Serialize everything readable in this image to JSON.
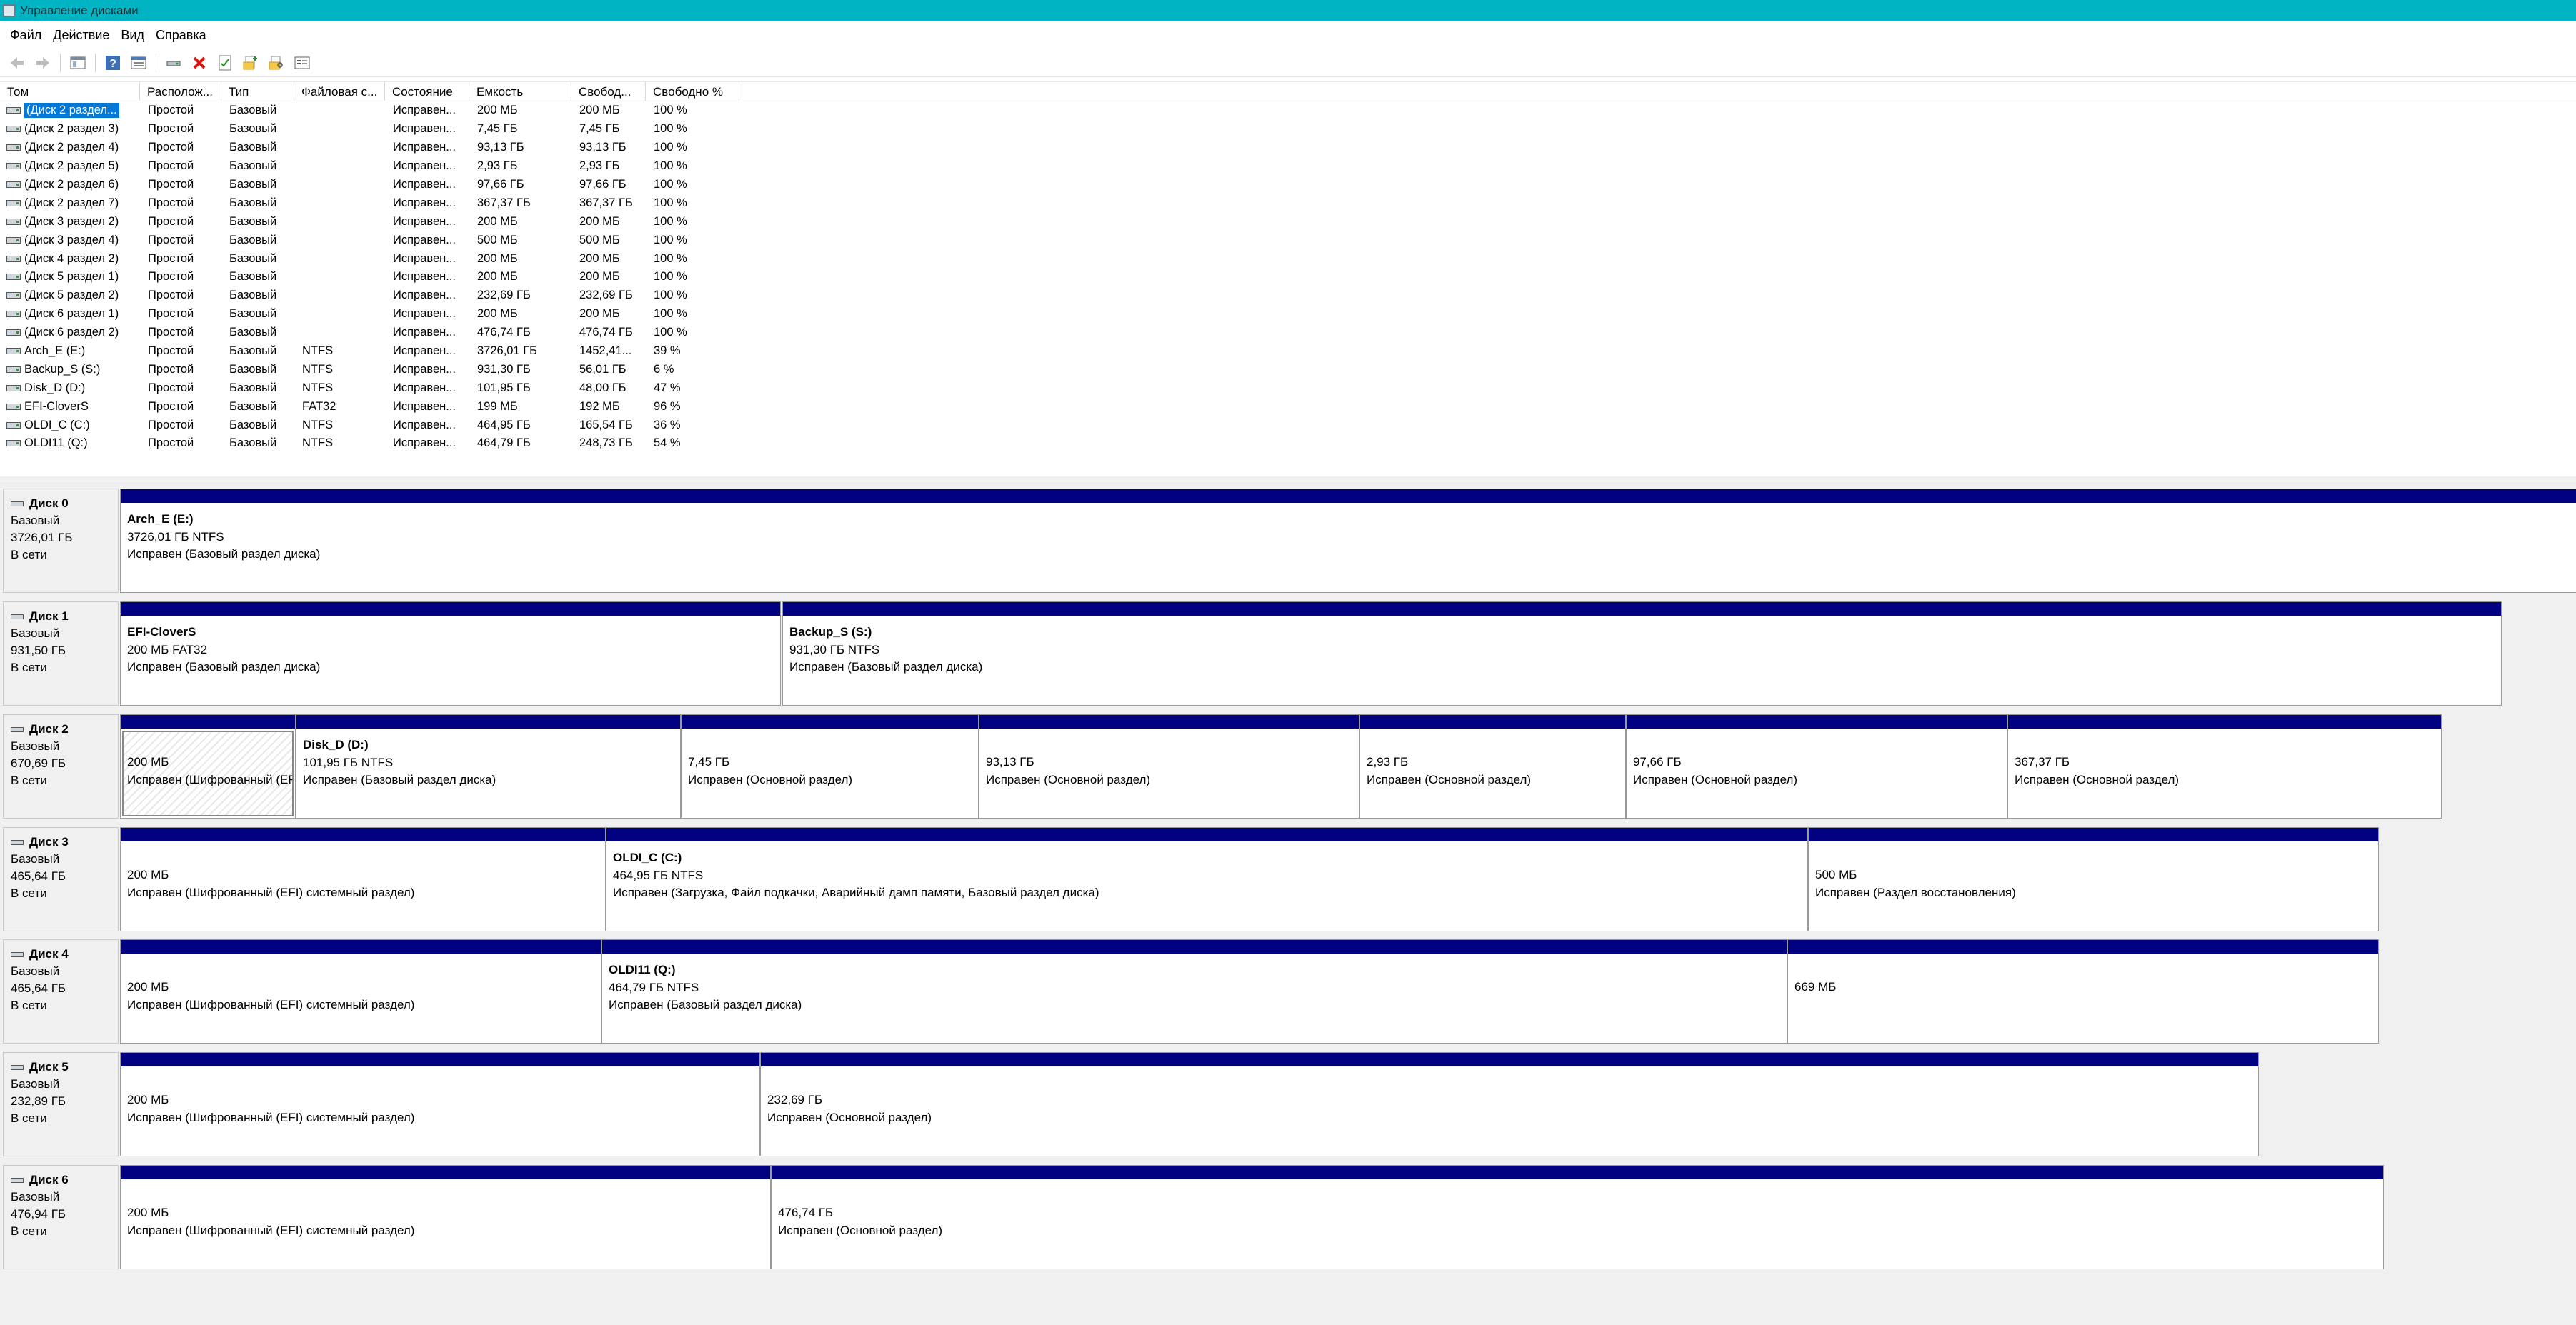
{
  "window": {
    "title": "Управление дисками"
  },
  "menu": [
    "Файл",
    "Действие",
    "Вид",
    "Справка"
  ],
  "toolbar_icons": [
    "back-arrow-icon",
    "forward-arrow-icon",
    "console-tree-icon",
    "help-icon",
    "list-view-icon",
    "connect-disk-icon",
    "delete-icon",
    "properties-icon",
    "folder-open-icon",
    "search-folder-icon",
    "settings-icon"
  ],
  "columns": [
    "Том",
    "Располож...",
    "Тип",
    "Файловая с...",
    "Состояние",
    "Емкость",
    "Свобод...",
    "Свободно %"
  ],
  "volumes": [
    [
      "(Диск 2 раздел...",
      "Простой",
      "Базовый",
      "",
      "Исправен...",
      "200 МБ",
      "200 МБ",
      "100 %"
    ],
    [
      "(Диск 2 раздел 3)",
      "Простой",
      "Базовый",
      "",
      "Исправен...",
      "7,45 ГБ",
      "7,45 ГБ",
      "100 %"
    ],
    [
      "(Диск 2 раздел 4)",
      "Простой",
      "Базовый",
      "",
      "Исправен...",
      "93,13 ГБ",
      "93,13 ГБ",
      "100 %"
    ],
    [
      "(Диск 2 раздел 5)",
      "Простой",
      "Базовый",
      "",
      "Исправен...",
      "2,93 ГБ",
      "2,93 ГБ",
      "100 %"
    ],
    [
      "(Диск 2 раздел 6)",
      "Простой",
      "Базовый",
      "",
      "Исправен...",
      "97,66 ГБ",
      "97,66 ГБ",
      "100 %"
    ],
    [
      "(Диск 2 раздел 7)",
      "Простой",
      "Базовый",
      "",
      "Исправен...",
      "367,37 ГБ",
      "367,37 ГБ",
      "100 %"
    ],
    [
      "(Диск 3 раздел 2)",
      "Простой",
      "Базовый",
      "",
      "Исправен...",
      "200 МБ",
      "200 МБ",
      "100 %"
    ],
    [
      "(Диск 3 раздел 4)",
      "Простой",
      "Базовый",
      "",
      "Исправен...",
      "500 МБ",
      "500 МБ",
      "100 %"
    ],
    [
      "(Диск 4 раздел 2)",
      "Простой",
      "Базовый",
      "",
      "Исправен...",
      "200 МБ",
      "200 МБ",
      "100 %"
    ],
    [
      "(Диск 5 раздел 1)",
      "Простой",
      "Базовый",
      "",
      "Исправен...",
      "200 МБ",
      "200 МБ",
      "100 %"
    ],
    [
      "(Диск 5 раздел 2)",
      "Простой",
      "Базовый",
      "",
      "Исправен...",
      "232,69 ГБ",
      "232,69 ГБ",
      "100 %"
    ],
    [
      "(Диск 6 раздел 1)",
      "Простой",
      "Базовый",
      "",
      "Исправен...",
      "200 МБ",
      "200 МБ",
      "100 %"
    ],
    [
      "(Диск 6 раздел 2)",
      "Простой",
      "Базовый",
      "",
      "Исправен...",
      "476,74 ГБ",
      "476,74 ГБ",
      "100 %"
    ],
    [
      "Arch_E (E:)",
      "Простой",
      "Базовый",
      "NTFS",
      "Исправен...",
      "3726,01 ГБ",
      "1452,41...",
      "39 %"
    ],
    [
      "Backup_S (S:)",
      "Простой",
      "Базовый",
      "NTFS",
      "Исправен...",
      "931,30 ГБ",
      "56,01 ГБ",
      "6 %"
    ],
    [
      "Disk_D (D:)",
      "Простой",
      "Базовый",
      "NTFS",
      "Исправен...",
      "101,95 ГБ",
      "48,00 ГБ",
      "47 %"
    ],
    [
      "EFI-CloverS",
      "Простой",
      "Базовый",
      "FAT32",
      "Исправен...",
      "199 МБ",
      "192 МБ",
      "96 %"
    ],
    [
      "OLDI_C (C:)",
      "Простой",
      "Базовый",
      "NTFS",
      "Исправен...",
      "464,95 ГБ",
      "165,54 ГБ",
      "36 %"
    ],
    [
      "OLDI11 (Q:)",
      "Простой",
      "Базовый",
      "NTFS",
      "Исправен...",
      "464,79 ГБ",
      "248,73 ГБ",
      "54 %"
    ]
  ],
  "disks": [
    {
      "name": "Диск 0",
      "type": "Базовый",
      "size": "3726,01 ГБ",
      "status": "В сети",
      "partitions": [
        {
          "label": "Arch_E  (E:)",
          "size": "3726,01 ГБ NTFS",
          "status": "Исправен (Базовый раздел диска)"
        }
      ]
    },
    {
      "name": "Диск 1",
      "type": "Базовый",
      "size": "931,50 ГБ",
      "status": "В сети",
      "partitions": [
        {
          "label": "EFI-CloverS",
          "size": "200 МБ FAT32",
          "status": "Исправен (Базовый раздел диска)"
        },
        {
          "label": "Backup_S  (S:)",
          "size": "931,30 ГБ NTFS",
          "status": "Исправен (Базовый раздел диска)"
        }
      ]
    },
    {
      "name": "Диск 2",
      "type": "Базовый",
      "size": "670,69 ГБ",
      "status": "В сети",
      "partitions": [
        {
          "label": "",
          "size": "200 МБ",
          "status": "Исправен (Шифрованный (EFI) системный раздел)",
          "hatch": true
        },
        {
          "label": "Disk_D  (D:)",
          "size": "101,95 ГБ NTFS",
          "status": "Исправен (Базовый раздел диска)"
        },
        {
          "label": "",
          "size": "7,45 ГБ",
          "status": "Исправен (Основной раздел)"
        },
        {
          "label": "",
          "size": "93,13 ГБ",
          "status": "Исправен (Основной раздел)"
        },
        {
          "label": "",
          "size": "2,93 ГБ",
          "status": "Исправен (Основной раздел)"
        },
        {
          "label": "",
          "size": "97,66 ГБ",
          "status": "Исправен (Основной раздел)"
        },
        {
          "label": "",
          "size": "367,37 ГБ",
          "status": "Исправен (Основной раздел)"
        }
      ]
    },
    {
      "name": "Диск 3",
      "type": "Базовый",
      "size": "465,64 ГБ",
      "status": "В сети",
      "partitions": [
        {
          "label": "",
          "size": "200 МБ",
          "status": "Исправен (Шифрованный (EFI) системный раздел)"
        },
        {
          "label": "OLDI_C  (C:)",
          "size": "464,95 ГБ NTFS",
          "status": "Исправен (Загрузка, Файл подкачки, Аварийный дамп памяти, Базовый раздел диска)"
        },
        {
          "label": "",
          "size": "500 МБ",
          "status": "Исправен (Раздел восстановления)"
        }
      ]
    },
    {
      "name": "Диск 4",
      "type": "Базовый",
      "size": "465,64 ГБ",
      "status": "В сети",
      "partitions": [
        {
          "label": "",
          "size": "200 МБ",
          "status": "Исправен (Шифрованный (EFI) системный раздел)"
        },
        {
          "label": "OLDI11  (Q:)",
          "size": "464,79 ГБ NTFS",
          "status": "Исправен (Базовый раздел диска)"
        },
        {
          "label": "",
          "size": "669 МБ",
          "status": ""
        }
      ]
    },
    {
      "name": "Диск 5",
      "type": "Базовый",
      "size": "232,89 ГБ",
      "status": "В сети",
      "partitions": [
        {
          "label": "",
          "size": "200 МБ",
          "status": "Исправен (Шифрованный (EFI) системный раздел)"
        },
        {
          "label": "",
          "size": "232,69 ГБ",
          "status": "Исправен (Основной раздел)"
        }
      ]
    },
    {
      "name": "Диск 6",
      "type": "Базовый",
      "size": "476,94 ГБ",
      "status": "В сети",
      "partitions": [
        {
          "label": "",
          "size": "200 МБ",
          "status": "Исправен (Шифрованный (EFI) системный раздел)"
        },
        {
          "label": "",
          "size": "476,74 ГБ",
          "status": "Исправен (Основной раздел)"
        }
      ]
    }
  ]
}
